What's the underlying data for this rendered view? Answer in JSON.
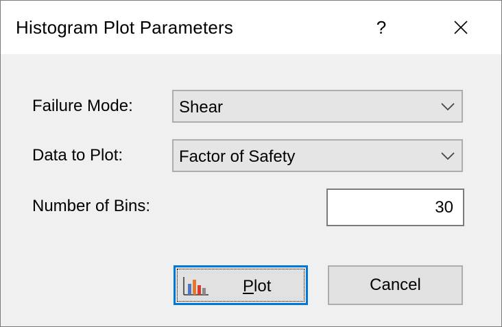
{
  "window": {
    "title": "Histogram Plot Parameters",
    "help_glyph": "?",
    "close_icon": "close-icon"
  },
  "form": {
    "failure_mode": {
      "label": "Failure Mode:",
      "value": "Shear"
    },
    "data_to_plot": {
      "label": "Data to Plot:",
      "value": "Factor of Safety"
    },
    "number_of_bins": {
      "label": "Number of Bins:",
      "value": "30"
    }
  },
  "buttons": {
    "plot": {
      "mnemonic": "P",
      "rest": "lot",
      "icon": "histogram-icon"
    },
    "cancel": {
      "label": "Cancel"
    }
  },
  "colors": {
    "focus_border": "#0078d7",
    "dialog_bg": "#f0f0f0",
    "titlebar_bg": "#ffffff"
  }
}
